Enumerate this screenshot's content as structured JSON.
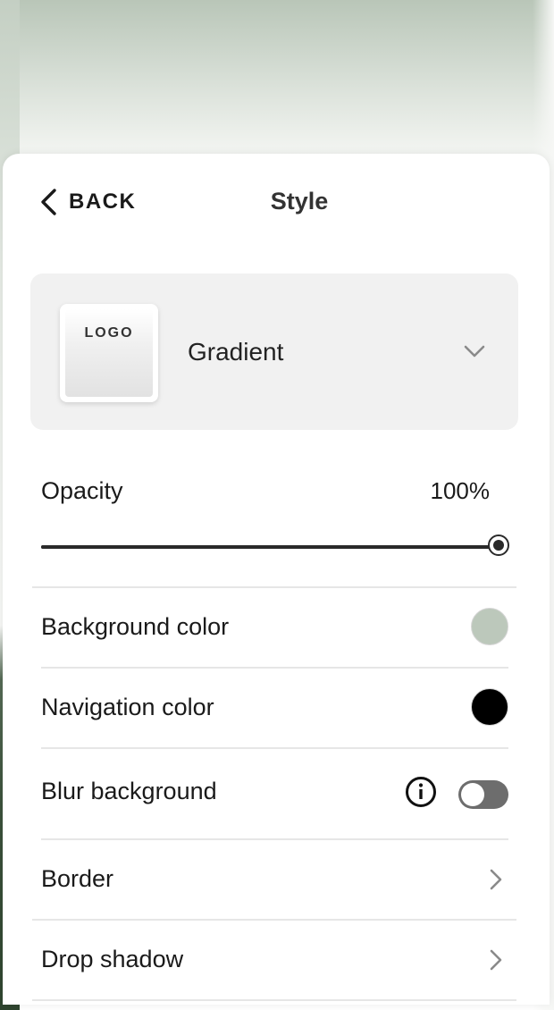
{
  "header": {
    "back_label": "BACK",
    "title": "Style"
  },
  "background_type": {
    "thumbnail_text": "LOGO",
    "selected": "Gradient"
  },
  "opacity": {
    "label": "Opacity",
    "value_text": "100%",
    "value": 1.0
  },
  "rows": {
    "background_color": {
      "label": "Background color",
      "color": "#bcc8bb"
    },
    "navigation_color": {
      "label": "Navigation color",
      "color": "#000000"
    },
    "blur_background": {
      "label": "Blur background",
      "enabled": false
    },
    "border": {
      "label": "Border"
    },
    "drop_shadow": {
      "label": "Drop shadow"
    }
  },
  "colors": {
    "toggle_off": "#6d6d6d",
    "text": "#1a1a1a"
  },
  "icons": {
    "back": "chevron-left-icon",
    "dropdown": "chevron-down-icon",
    "info": "info-icon",
    "row_arrow": "chevron-right-icon"
  }
}
